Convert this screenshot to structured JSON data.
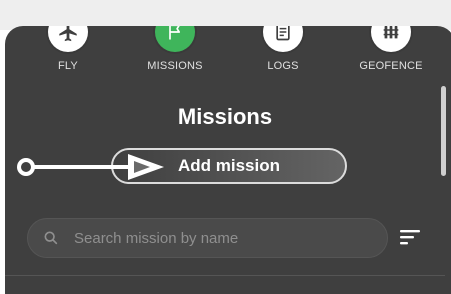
{
  "nav": {
    "items": [
      {
        "label": "FLY",
        "icon": "plane-icon"
      },
      {
        "label": "MISSIONS",
        "icon": "flag-icon",
        "active": true
      },
      {
        "label": "LOGS",
        "icon": "document-icon"
      },
      {
        "label": "GEOFENCE",
        "icon": "fence-icon"
      }
    ]
  },
  "main": {
    "title": "Missions",
    "add_button_label": "Add mission",
    "search": {
      "placeholder": "Search mission by name",
      "value": ""
    }
  },
  "colors": {
    "panel": "#3f3f3f",
    "accent": "#3fb55b"
  }
}
